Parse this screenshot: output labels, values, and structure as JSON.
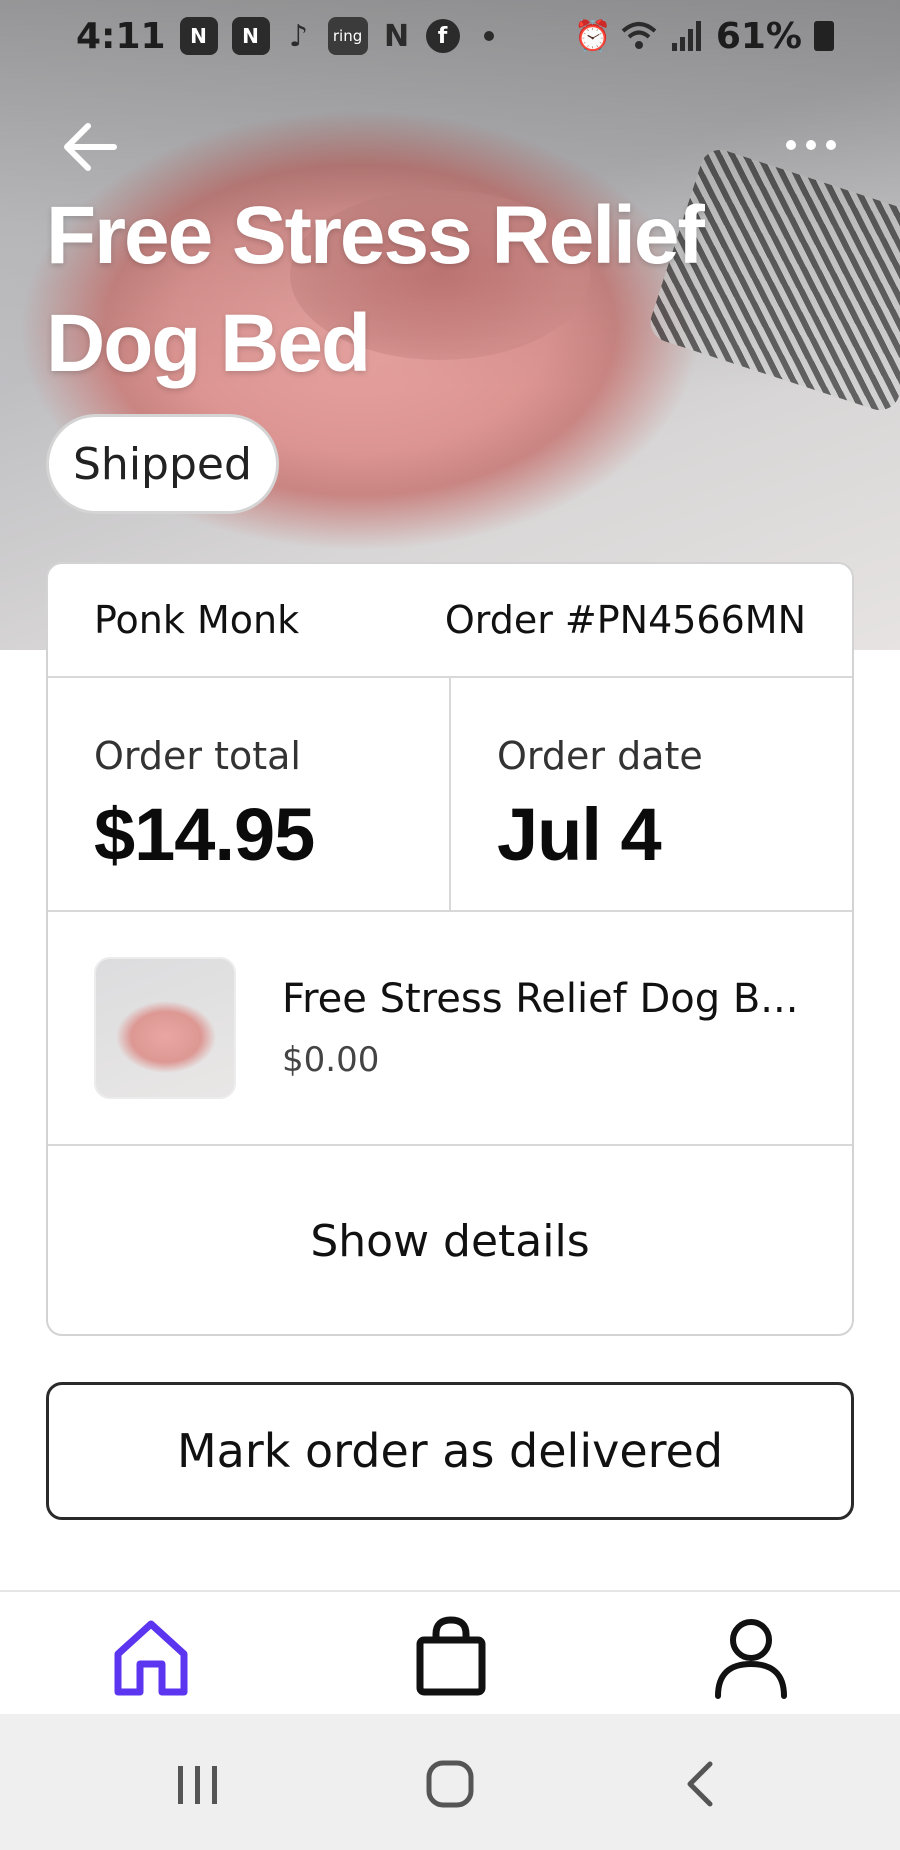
{
  "status_bar": {
    "time": "4:11",
    "battery": "61%",
    "ring_label": "ring"
  },
  "header": {
    "title": "Free Stress Relief Dog Bed",
    "status_badge": "Shipped"
  },
  "order": {
    "store": "Ponk Monk",
    "order_number": "Order #PN4566MN",
    "total_label": "Order total",
    "total_value": "$14.95",
    "date_label": "Order date",
    "date_value": "Jul 4",
    "item_name": "Free Stress Relief Dog B...",
    "item_price": "$0.00",
    "show_details": "Show details"
  },
  "actions": {
    "mark_delivered": "Mark order as delivered"
  },
  "bottom_nav": {
    "items": [
      "home",
      "shop",
      "profile"
    ],
    "active": "home"
  },
  "colors": {
    "accent": "#5b35f0",
    "text": "#111111",
    "border": "#d3d3d3"
  }
}
